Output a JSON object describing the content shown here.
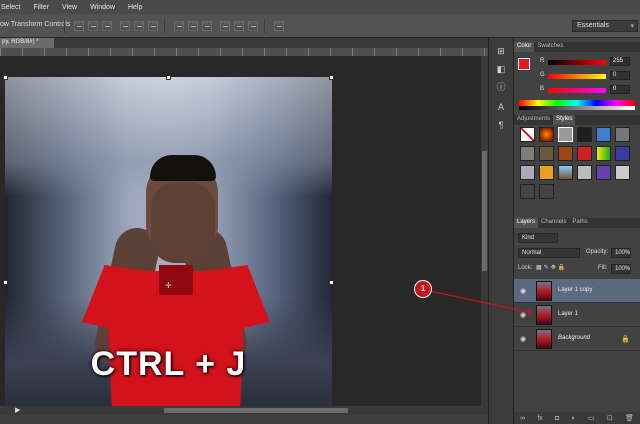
{
  "menu": [
    "Select",
    "Filter",
    "View",
    "Window",
    "Help"
  ],
  "options": {
    "show_transform": "ow Transform Controls",
    "workspace": "Essentials"
  },
  "document": {
    "tab_label": "py, RGB/8#) *",
    "caption": "CTRL + J"
  },
  "color_panel": {
    "tabs": [
      "Color",
      "Swatches"
    ],
    "channels": [
      {
        "label": "R",
        "value": "255"
      },
      {
        "label": "G",
        "value": "0"
      },
      {
        "label": "B",
        "value": "0"
      }
    ],
    "foreground": "#e8171e"
  },
  "adjust_panel": {
    "tabs": [
      "Adjustments",
      "Styles"
    ]
  },
  "layers_panel": {
    "tabs": [
      "Layers",
      "Channels",
      "Paths"
    ],
    "kind_filter": "Kind",
    "blend_mode": "Normal",
    "opacity_label": "Opacity:",
    "opacity_value": "100%",
    "lock_label": "Lock:",
    "fill_label": "Fill:",
    "fill_value": "100%",
    "layers": [
      {
        "name": "Layer 1 copy",
        "selected": true
      },
      {
        "name": "Layer 1",
        "selected": false
      },
      {
        "name": "Background",
        "selected": false
      }
    ]
  },
  "annotation": {
    "number": "1",
    "color": "#c4131b"
  }
}
